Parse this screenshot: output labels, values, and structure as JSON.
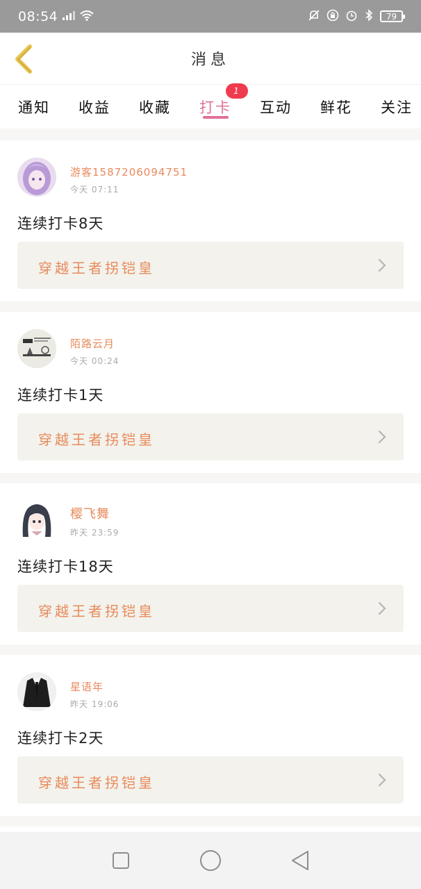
{
  "status_bar": {
    "time": "08:54",
    "battery": "79",
    "icons": [
      "signal-icon",
      "wifi-icon",
      "mute-icon",
      "lock-icon",
      "alarm-icon",
      "bluetooth-icon",
      "battery-icon"
    ]
  },
  "header": {
    "title": "消息",
    "back_icon": "chevron-left-icon"
  },
  "tabs": [
    {
      "label": "通知"
    },
    {
      "label": "收益"
    },
    {
      "label": "收藏"
    },
    {
      "label": "打卡",
      "badge": "1",
      "active": true
    },
    {
      "label": "互动"
    },
    {
      "label": "鲜花"
    },
    {
      "label": "关注"
    }
  ],
  "messages": [
    {
      "user": "游客1587206094751",
      "time": "今天 07:11",
      "text": "连续打卡8天",
      "book": "穿越王者拐铠皇"
    },
    {
      "user": "陌路云月",
      "time": "今天 00:24",
      "text": "连续打卡1天",
      "book": "穿越王者拐铠皇"
    },
    {
      "user": "樱飞舞",
      "time": "昨天 23:59",
      "text": "连续打卡18天",
      "book": "穿越王者拐铠皇"
    },
    {
      "user": "星语年",
      "time": "昨天 19:06",
      "text": "连续打卡2天",
      "book": "穿越王者拐铠皇"
    }
  ],
  "colors": {
    "accent_pink": "#e0709c",
    "username_orange": "#e88a5c",
    "badge_red": "#ef3b4d",
    "back_arrow_yellow": "#e9c34b"
  },
  "nav_bar": [
    "square-icon",
    "circle-icon",
    "triangle-back-icon"
  ]
}
